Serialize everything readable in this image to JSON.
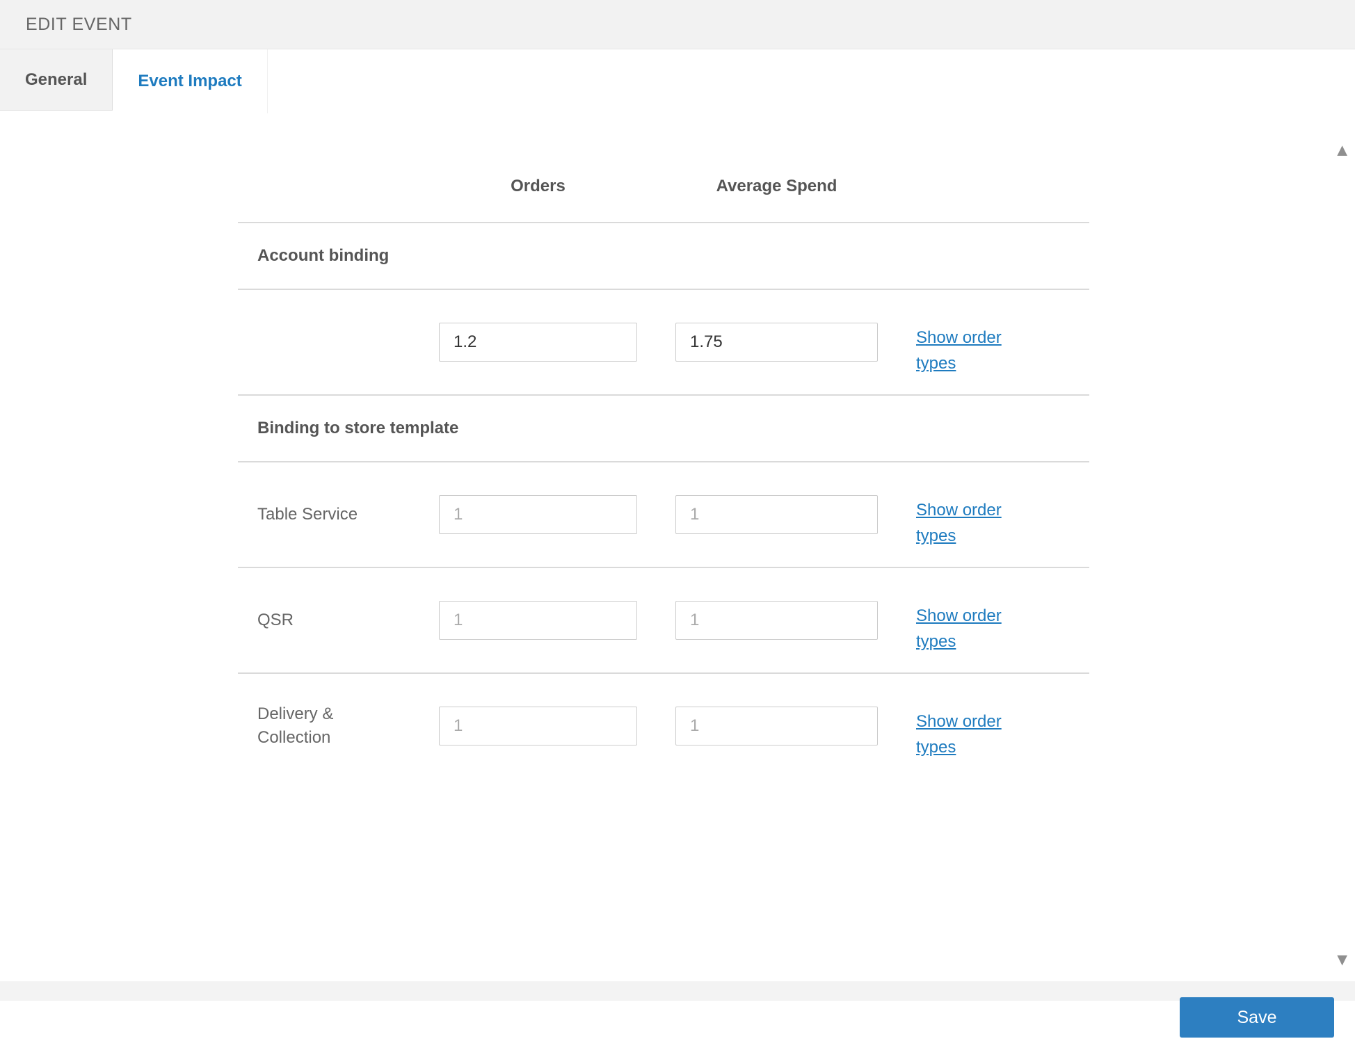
{
  "titlebar": {
    "title": "EDIT EVENT"
  },
  "tabs": {
    "general": "General",
    "event_impact": "Event Impact"
  },
  "columns": {
    "orders": "Orders",
    "average_spend": "Average Spend"
  },
  "sections": {
    "account_binding": {
      "title": "Account binding",
      "row": {
        "orders_value": "1.2",
        "spend_value": "1.75",
        "link": "Show order types"
      }
    },
    "store_template": {
      "title": "Binding to store template",
      "rows": [
        {
          "label": "Table Service",
          "orders_placeholder": "1",
          "spend_placeholder": "1",
          "link": "Show order types"
        },
        {
          "label": "QSR",
          "orders_placeholder": "1",
          "spend_placeholder": "1",
          "link": "Show order types"
        },
        {
          "label": "Delivery & Collection",
          "orders_placeholder": "1",
          "spend_placeholder": "1",
          "link": "Show order types"
        }
      ]
    }
  },
  "scrollbar": {
    "up_icon": "▲",
    "down_icon": "▼"
  },
  "footer": {
    "save": "Save"
  },
  "colors": {
    "accent": "#2d7fc1",
    "link": "#1e7bbf"
  }
}
